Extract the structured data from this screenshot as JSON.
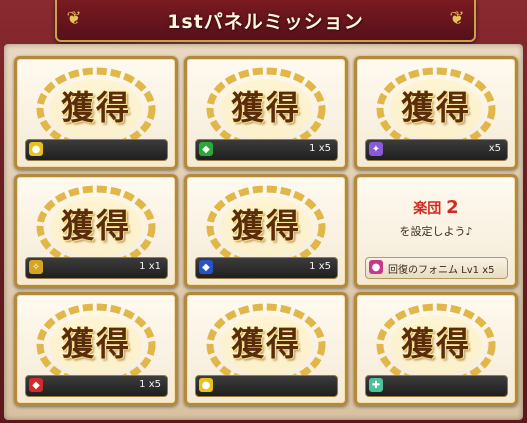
{
  "title": "1stパネルミッション",
  "stamp_text": "獲得",
  "panels": [
    {
      "status": "acquired",
      "icon": "gold-coin-icon",
      "icon_color": "#e8c21a",
      "quantity": ""
    },
    {
      "status": "acquired",
      "icon": "green-gem-icon",
      "icon_color": "#2aa83a",
      "quantity": "1 x5"
    },
    {
      "status": "acquired",
      "icon": "magic-gems-icon",
      "icon_color": "#8a5ad8",
      "quantity": "x5"
    },
    {
      "status": "acquired",
      "icon": "wand-icon",
      "icon_color": "#d6a322",
      "quantity": "1 x1"
    },
    {
      "status": "acquired",
      "icon": "blue-gem-icon",
      "icon_color": "#2a52c8",
      "quantity": "1 x5"
    },
    {
      "status": "pending",
      "title_prefix": "楽団",
      "title_number": "2",
      "subtitle": "を設定しよう♪",
      "icon": "recovery-femnium-icon",
      "icon_color": "#c8388a",
      "reward": "回復のフォニム Lv1 x5"
    },
    {
      "status": "acquired",
      "icon": "red-gem-icon",
      "icon_color": "#d22a2a",
      "quantity": "1 x5"
    },
    {
      "status": "acquired",
      "icon": "gold-coin-icon",
      "icon_color": "#e8c21a",
      "quantity": ""
    },
    {
      "status": "acquired",
      "icon": "ticket-icon",
      "icon_color": "#4ec0a0",
      "quantity": ""
    }
  ]
}
